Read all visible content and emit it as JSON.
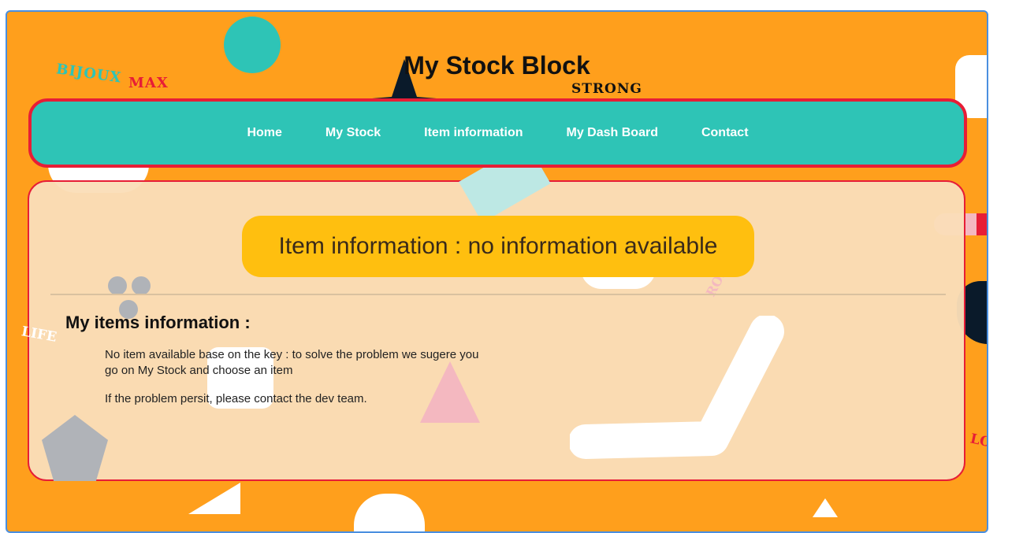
{
  "site": {
    "title": "My Stock Block"
  },
  "nav": {
    "items": [
      {
        "label": "Home"
      },
      {
        "label": "My Stock"
      },
      {
        "label": "Item information"
      },
      {
        "label": "My Dash Board"
      },
      {
        "label": "Contact"
      }
    ]
  },
  "main": {
    "badge": "Item information : no information available",
    "section_title": "My items information :",
    "message1": "No item available base on the key : to solve the problem we sugere you go on My Stock and choose an item",
    "message2": "If the problem persit, please contact the dev team."
  },
  "decor": {
    "bijoux": "BIJOUX",
    "max": "MAX",
    "strong": "STRONG",
    "life": "LIFE",
    "rose": "ROSE",
    "lo": "LO"
  },
  "colors": {
    "background": "#ff9f1c",
    "nav": "#2ec4b6",
    "border": "#e71d36",
    "badge": "#ffbf0f",
    "panel": "#fadeb8"
  }
}
